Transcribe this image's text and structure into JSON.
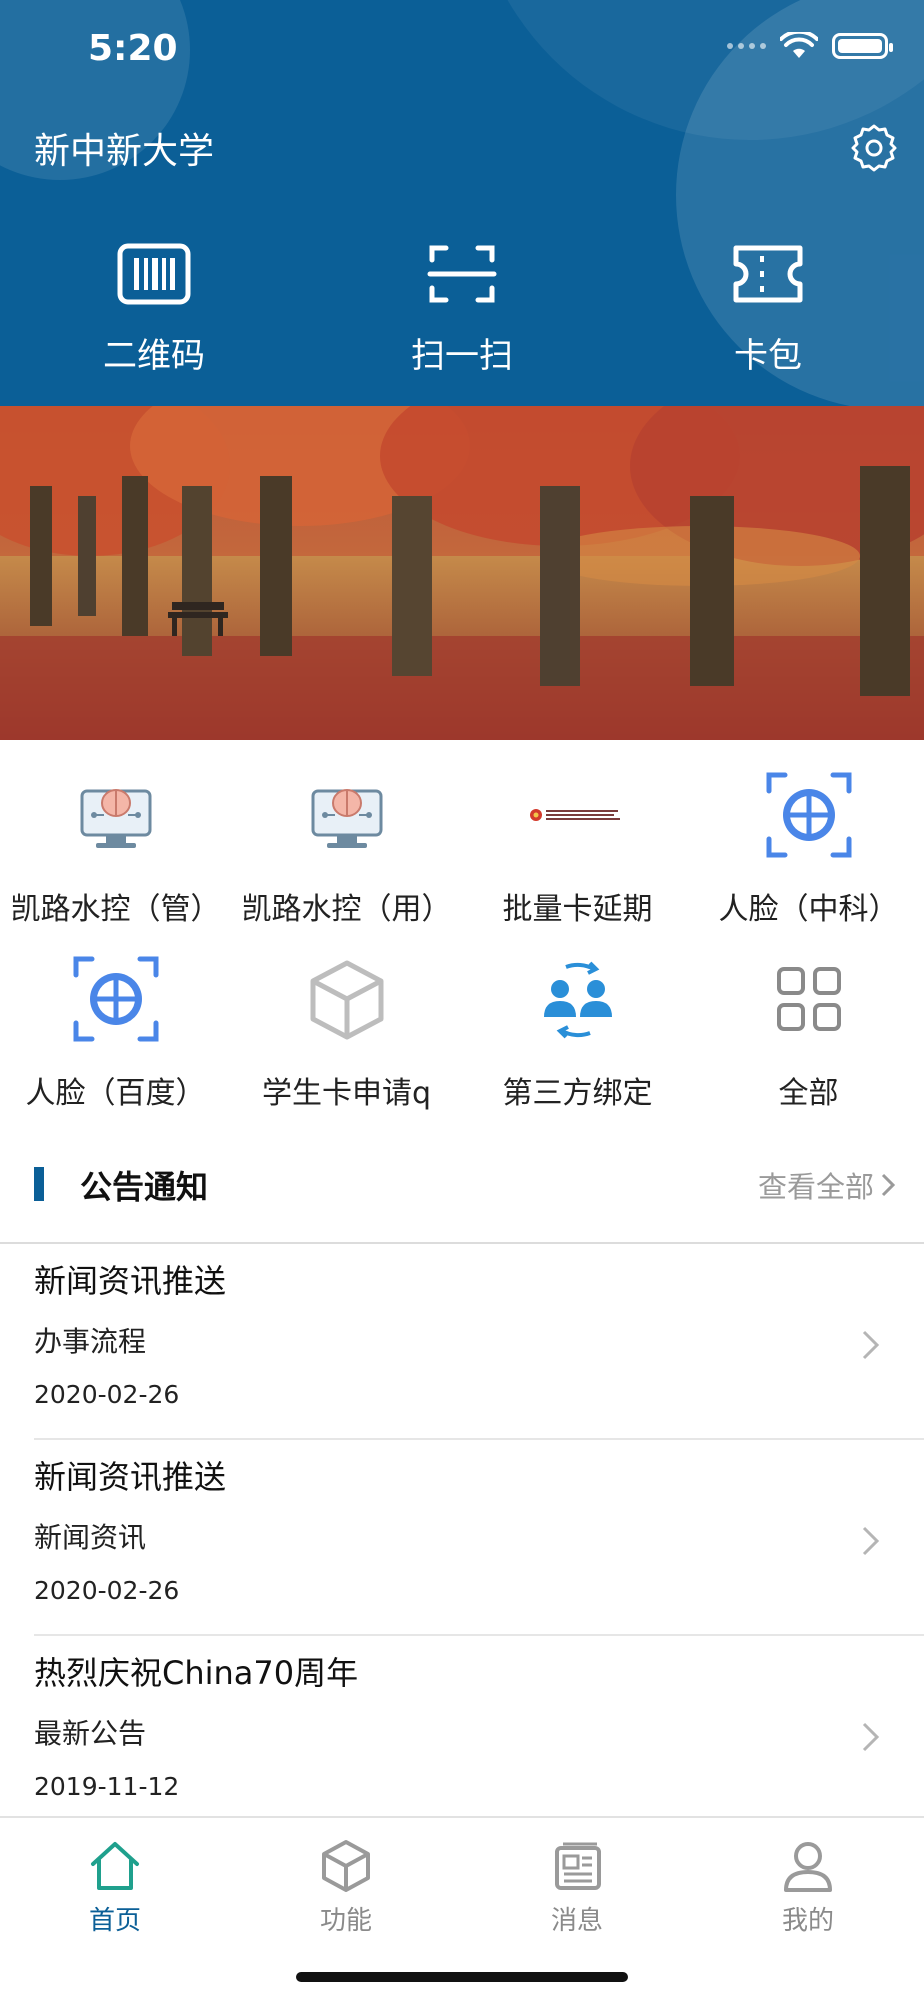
{
  "status": {
    "time": "5:20"
  },
  "header": {
    "school_name": "新中新大学"
  },
  "quick_actions": [
    {
      "label": "二维码",
      "icon": "barcode-icon"
    },
    {
      "label": "扫一扫",
      "icon": "scan-icon"
    },
    {
      "label": "卡包",
      "icon": "card-wallet-icon"
    }
  ],
  "banner": {
    "slide_count": 5,
    "active_index": 1
  },
  "grid": [
    {
      "label": "凯路水控（管）",
      "icon": "brain-monitor-icon"
    },
    {
      "label": "凯路水控（用）",
      "icon": "brain-monitor-icon"
    },
    {
      "label": "批量卡延期",
      "icon": "college-logo-icon"
    },
    {
      "label": "人脸（中科）",
      "icon": "face-scan-icon"
    },
    {
      "label": "人脸（百度）",
      "icon": "face-scan-icon"
    },
    {
      "label": "学生卡申请q",
      "icon": "cube-icon"
    },
    {
      "label": "第三方绑定",
      "icon": "user-sync-icon"
    },
    {
      "label": "全部",
      "icon": "grid-icon"
    }
  ],
  "notice": {
    "title": "公告通知",
    "view_all": "查看全部"
  },
  "news": [
    {
      "title": "新闻资讯推送",
      "category": "办事流程",
      "date": "2020-02-26"
    },
    {
      "title": "新闻资讯推送",
      "category": "新闻资讯",
      "date": "2020-02-26"
    },
    {
      "title": "热烈庆祝China70周年",
      "category": "最新公告",
      "date": "2019-11-12"
    }
  ],
  "tabs": [
    {
      "label": "首页",
      "icon": "home-icon",
      "active": true
    },
    {
      "label": "功能",
      "icon": "cube-icon",
      "active": false
    },
    {
      "label": "消息",
      "icon": "newspaper-icon",
      "active": false
    },
    {
      "label": "我的",
      "icon": "person-icon",
      "active": false
    }
  ],
  "colors": {
    "primary": "#0b5f97",
    "accent_blue": "#4a86e8",
    "muted": "#9a9a9a"
  }
}
